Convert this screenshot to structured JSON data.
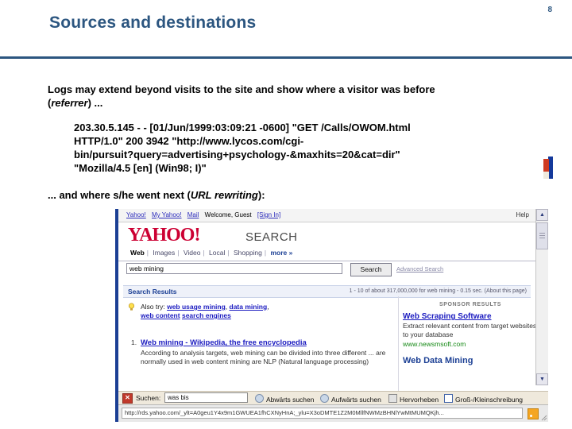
{
  "slide": {
    "title": "Sources and destinations",
    "page_number": "8",
    "title_color": "#2c5680",
    "paragraph_1_a": "Logs may extend beyond visits to the site and show where a visitor was before",
    "paragraph_1_b_italic": "referrer",
    "paragraph_1_c": ") ...",
    "paragraph_1_open": "(",
    "log_lines": [
      "203.30.5.145 - - [01/Jun/1999:03:09:21 -0600] \"GET /Calls/OWOM.html",
      "HTTP/1.0\" 200 3942 \"http://www.lycos.com/cgi-",
      "bin/pursuit?query=advertising+psychology-&maxhits=20&cat=dir\"",
      "\"Mozilla/4.5 [en] (Win98; I)\""
    ],
    "paragraph_2_a": "... and where s/he went next (",
    "paragraph_2_b_italic": "URL rewriting",
    "paragraph_2_c": "):"
  },
  "browser": {
    "topnav": {
      "links": [
        "Yahoo!",
        "My Yahoo!",
        "Mail"
      ],
      "welcome": "Welcome, Guest",
      "signin": "[Sign In]",
      "help": "Help"
    },
    "logo": "YAHOO!",
    "logo_suffix": "SEARCH",
    "tabs": [
      {
        "label": "Web",
        "selected": true
      },
      {
        "label": "Images",
        "selected": false
      },
      {
        "label": "Video",
        "selected": false
      },
      {
        "label": "Local",
        "selected": false
      },
      {
        "label": "Shopping",
        "selected": false
      },
      {
        "label": "more »",
        "selected": false
      }
    ],
    "search": {
      "value": "web mining",
      "placeholder": "",
      "button_label": "Search",
      "advanced_label": "Advanced Search"
    },
    "results_header": {
      "title": "Search Results",
      "count": "1 - 10 of about 317,000,000 for web mining - 0.15 sec. (About this page)"
    },
    "also_try": {
      "label": "Also try:",
      "items": [
        "web usage mining",
        "data mining",
        "web content",
        "search engines"
      ]
    },
    "results": [
      {
        "number": "1.",
        "title": "Web mining",
        "title_rest": " - Wikipedia, the free encyclopedia",
        "description": "According to analysis targets, web mining can be divided into three different ... are normally used in web content mining are NLP (Natural language processing)"
      }
    ],
    "sponsor": {
      "header": "SPONSOR RESULTS",
      "items": [
        {
          "title": "Web Scraping Software",
          "description": "Extract relevant content from target websites to your database",
          "url": "www.newsmsoft.com"
        },
        {
          "title": "Web Data Mining",
          "description": "",
          "url": ""
        }
      ]
    },
    "findbar": {
      "label": "Suchen:",
      "value": "was bis",
      "down_label": "Abwärts suchen",
      "up_label": "Aufwärts suchen",
      "highlight_label": "Hervorheben",
      "matchcase_label": "Groß-/Kleinschreibung"
    },
    "statusbar": {
      "url": "http://rds.yahoo.com/_ylt=A0geu1Y4x9m1GWUEA1fhCXNyHnA;_ylu=X3oDMTE1Z2M0MllfNWMzBHNlYwMtMUMQKjh...",
      "rss_icon": "rss-icon"
    }
  }
}
